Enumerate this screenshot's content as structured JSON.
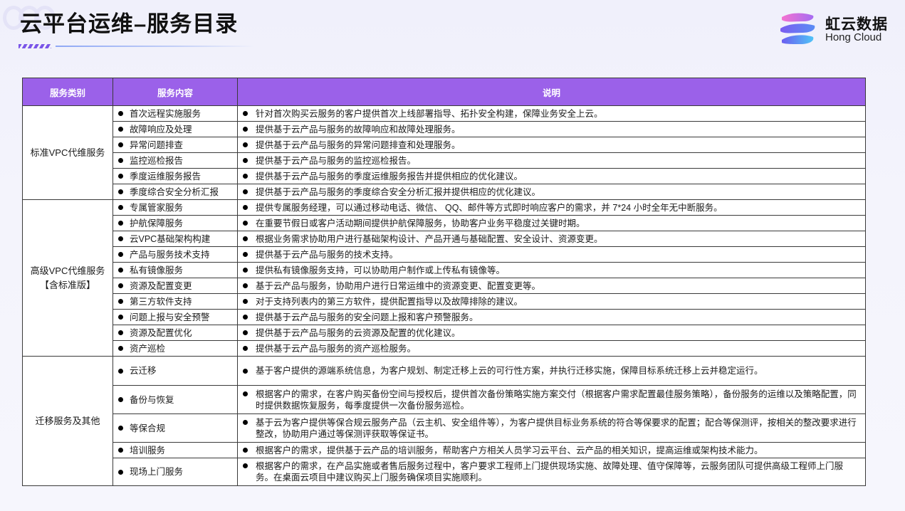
{
  "header": {
    "title": "云平台运维–服务目录"
  },
  "brand": {
    "name_cn": "虹云数据",
    "name_en": "Hong Cloud",
    "colors": [
      "#f06bd0",
      "#8a5cf0",
      "#4fc3f7"
    ]
  },
  "table": {
    "header_color": "#9b61e9",
    "columns": [
      "服务类别",
      "服务内容",
      "说明"
    ],
    "groups": [
      {
        "category": "标准VPC代维服务",
        "rows": [
          {
            "service": "首次远程实施服务",
            "desc": "针对首次购买云服务的客户提供首次上线部署指导、拓扑安全构建，保障业务安全上云。"
          },
          {
            "service": "故障响应及处理",
            "desc": "提供基于云产品与服务的故障响应和故障处理服务。"
          },
          {
            "service": "异常问题排查",
            "desc": "提供基于云产品与服务的异常问题排查和处理服务。"
          },
          {
            "service": "监控巡检报告",
            "desc": "提供基于云产品与服务的监控巡检报告。"
          },
          {
            "service": "季度运维服务报告",
            "desc": "提供基于云产品与服务的季度运维服务报告并提供相应的优化建议。"
          },
          {
            "service": "季度综合安全分析汇报",
            "desc": "提供基于云产品与服务的季度综合安全分析汇报并提供相应的优化建议。"
          }
        ]
      },
      {
        "category": "高级VPC代维服务",
        "category_note": "【含标准版】",
        "rows": [
          {
            "service": "专属管家服务",
            "desc": "提供专属服务经理，可以通过移动电话、微信、 QQ、邮件等方式即时响应客户的需求，并 7*24 小时全年无中断服务。"
          },
          {
            "service": "护航保障服务",
            "desc": "在重要节假日或客户活动期间提供护航保障服务，协助客户业务平稳度过关键时期。"
          },
          {
            "service": "云VPC基础架构构建",
            "desc": "根据业务需求协助用户进行基础架构设计、产品开通与基础配置、安全设计、资源变更。"
          },
          {
            "service": "产品与服务技术支持",
            "desc": "提供基于云产品与服务的技术支持。"
          },
          {
            "service": "私有镜像服务",
            "desc": "提供私有镜像服务支持，可以协助用户制作或上传私有镜像等。"
          },
          {
            "service": "资源及配置变更",
            "desc": "基于云产品与服务，协助用户进行日常运维中的资源变更、配置变更等。"
          },
          {
            "service": "第三方软件支持",
            "desc": "对于支持列表内的第三方软件，提供配置指导以及故障排除的建议。"
          },
          {
            "service": "问题上报与安全预警",
            "desc": "提供基于云产品与服务的安全问题上报和客户预警服务。"
          },
          {
            "service": "资源及配置优化",
            "desc": "提供基于云产品与服务的云资源及配置的优化建议。"
          },
          {
            "service": "资产巡检",
            "desc": "提供基于云产品与服务的资产巡检服务。"
          }
        ]
      },
      {
        "category": "迁移服务及其他",
        "rows": [
          {
            "service": "云迁移",
            "desc": "基于客户提供的源端系统信息，为客户规划、制定迁移上云的可行性方案，并执行迁移实施，保障目标系统迁移上云并稳定运行。"
          },
          {
            "service": "备份与恢复",
            "desc": "根据客户的需求，在客户购买备份空间与授权后，提供首次备份策略实施方案交付（根据客户需求配置最佳服务策略），备份服务的运维以及策略配置，同时提供数据恢复服务，每季度提供一次备份服务巡检。"
          },
          {
            "service": "等保合规",
            "desc": "基于云为客户提供等保合规云服务产品（云主机、安全组件等），为客户提供目标业务系统的符合等保要求的配置；配合等保测评，按相关的整改要求进行整改，协助用户通过等保测评获取等保证书。"
          },
          {
            "service": "培训服务",
            "desc": "根据客户的需求，提供基于云产品的培训服务，帮助客户方相关人员学习云平台、云产品的相关知识，提高运维或架构技术能力。"
          },
          {
            "service": "现场上门服务",
            "desc": "根据客户的需求，在产品实施或者售后服务过程中，客户要求工程师上门提供现场实施、故障处理、值守保障等，云服务团队可提供高级工程师上门服务。在桌面云项目中建议购买上门服务确保项目实施顺利。"
          }
        ]
      }
    ]
  }
}
